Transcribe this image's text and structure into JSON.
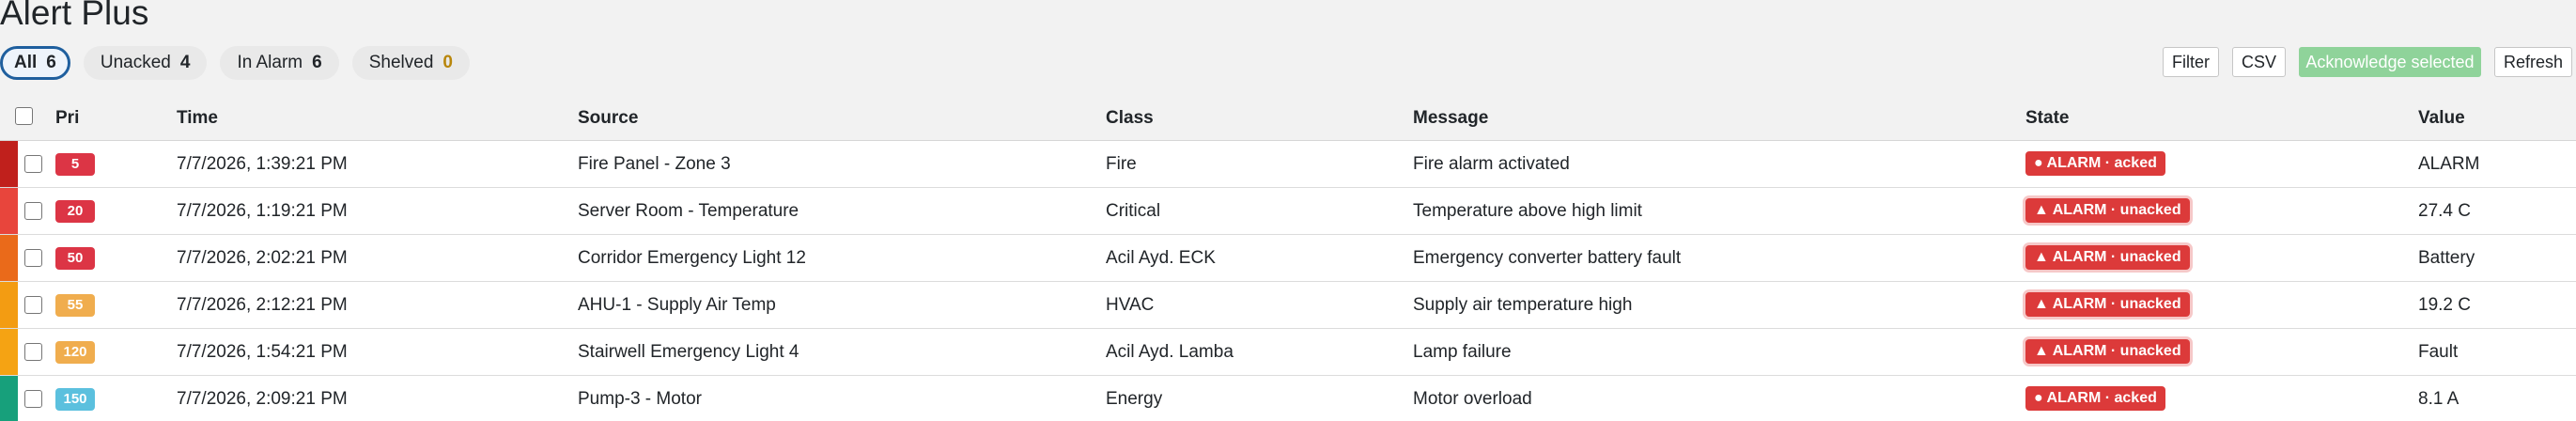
{
  "app": {
    "title": "Alert Plus"
  },
  "filters": [
    {
      "label": "All",
      "count": "6"
    },
    {
      "label": "Unacked",
      "count": "4"
    },
    {
      "label": "In Alarm",
      "count": "6"
    },
    {
      "label": "Shelved",
      "count": "0"
    }
  ],
  "toolbar": {
    "filter": "Filter",
    "csv": "CSV",
    "acknowledge": "Acknowledge selected",
    "refresh": "Refresh"
  },
  "columns": {
    "pri": "Pri",
    "time": "Time",
    "source": "Source",
    "class": "Class",
    "message": "Message",
    "state": "State",
    "value": "Value"
  },
  "colors": {
    "severity": [
      "#c0201c",
      "#e8453c",
      "#ea6a1a",
      "#f39c12",
      "#f5a313",
      "#17a07b"
    ],
    "priority": [
      "#dc3545",
      "#dc3545",
      "#dc3545",
      "#f0ad4e",
      "#f0ad4e",
      "#5bc0de"
    ],
    "state_badge": "#dc3a3a",
    "acknowledge_button": "#8fd39a"
  },
  "rows": [
    {
      "pri": "5",
      "time": "7/7/2026, 1:39:21 PM",
      "source": "Fire Panel - Zone 3",
      "class": "Fire",
      "message": "Fire alarm activated",
      "state": "● ALARM · acked",
      "value": "ALARM"
    },
    {
      "pri": "20",
      "time": "7/7/2026, 1:19:21 PM",
      "source": "Server Room - Temperature",
      "class": "Critical",
      "message": "Temperature above high limit",
      "state": "▲ ALARM · unacked",
      "value": "27.4 C"
    },
    {
      "pri": "50",
      "time": "7/7/2026, 2:02:21 PM",
      "source": "Corridor Emergency Light 12",
      "class": "Acil Ayd. ECK",
      "message": "Emergency converter battery fault",
      "state": "▲ ALARM · unacked",
      "value": "Battery"
    },
    {
      "pri": "55",
      "time": "7/7/2026, 2:12:21 PM",
      "source": "AHU-1 - Supply Air Temp",
      "class": "HVAC",
      "message": "Supply air temperature high",
      "state": "▲ ALARM · unacked",
      "value": "19.2 C"
    },
    {
      "pri": "120",
      "time": "7/7/2026, 1:54:21 PM",
      "source": "Stairwell Emergency Light 4",
      "class": "Acil Ayd. Lamba",
      "message": "Lamp failure",
      "state": "▲ ALARM · unacked",
      "value": "Fault"
    },
    {
      "pri": "150",
      "time": "7/7/2026, 2:09:21 PM",
      "source": "Pump-3 - Motor",
      "class": "Energy",
      "message": "Motor overload",
      "state": "● ALARM · acked",
      "value": "8.1 A"
    }
  ]
}
